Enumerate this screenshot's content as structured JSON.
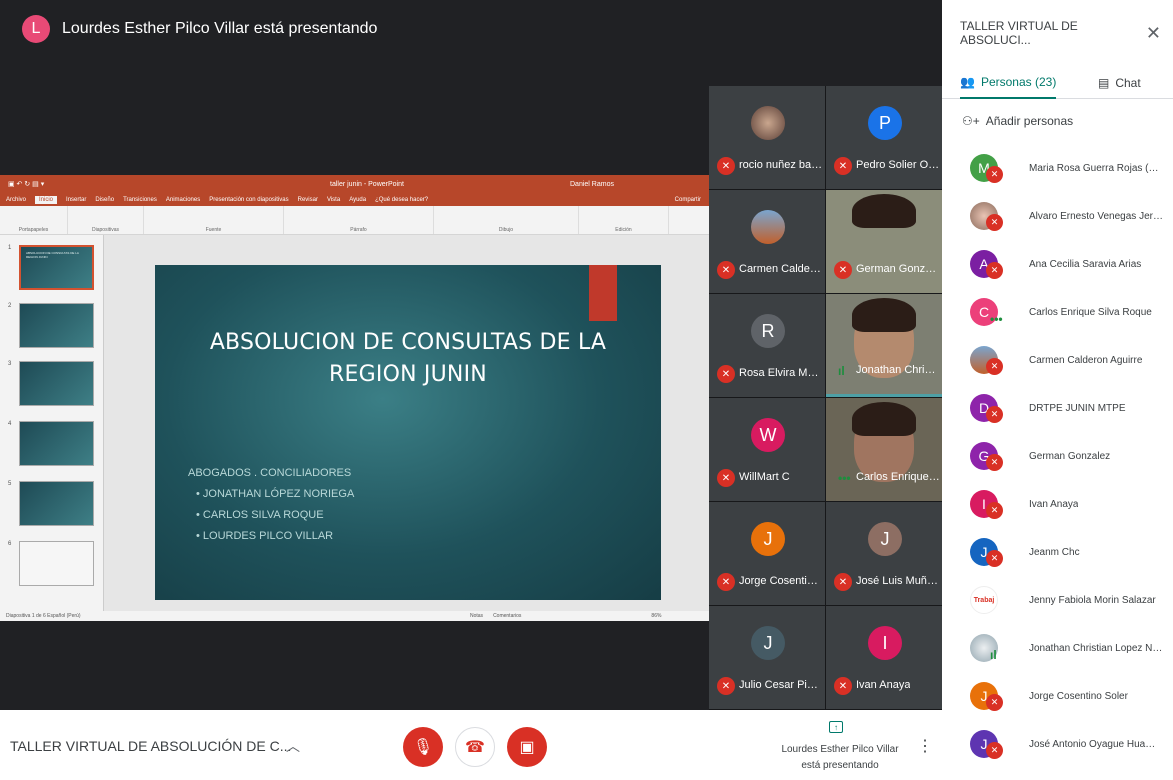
{
  "presenter": {
    "initial": "L",
    "text": "Lourdes Esther Pilco Villar está presentando"
  },
  "ppt": {
    "title": "taller junin - PowerPoint",
    "user": "Daniel Ramos",
    "tabs": [
      "Archivo",
      "Inicio",
      "Insertar",
      "Diseño",
      "Transiciones",
      "Animaciones",
      "Presentación con diapositivas",
      "Revisar",
      "Vista",
      "Ayuda",
      "¿Qué desea hacer?"
    ],
    "share": "Compartir",
    "ribbon_groups": [
      "Portapapeles",
      "Diapositivas",
      "Fuente",
      "Párrafo",
      "Dibujo",
      "Edición"
    ],
    "slide_title_1": "ABSOLUCION DE CONSULTAS DE LA",
    "slide_title_2": "REGION JUNIN",
    "slide_body": [
      "ABOGADOS . CONCILIADORES",
      "•  JONATHAN LÓPEZ NORIEGA",
      "•  CARLOS SILVA ROQUE",
      "•  LOURDES PILCO VILLAR"
    ],
    "status_left": "Diapositiva 1 de 6    Español (Perú)",
    "status_notes": "Notas",
    "status_comments": "Comentarios",
    "zoom": "86%",
    "thumb_numbers": [
      "1",
      "2",
      "3",
      "4",
      "5",
      "6"
    ],
    "thumb_texts": [
      "ABSOLUCION DE CONSULTAS DE LA REGION JUNIN",
      "",
      "",
      "",
      "",
      ""
    ]
  },
  "tiles": [
    {
      "name": "rocio nuñez bailon",
      "initial": "",
      "color": "#7d5a4e"
    },
    {
      "name": "Pedro Solier Och...",
      "initial": "P",
      "color": "#1a73e8"
    },
    {
      "name": "Carmen Caldero...",
      "initial": "",
      "color": "#c1602c"
    },
    {
      "name": "German Gonzalez",
      "initial": "",
      "color": ""
    },
    {
      "name": "Rosa Elvira Muda...",
      "initial": "R",
      "color": "#5f6368"
    },
    {
      "name": "Jonathan Christi...",
      "initial": "",
      "color": ""
    },
    {
      "name": "WillMart C",
      "initial": "W",
      "color": "#d81b60"
    },
    {
      "name": "Carlos Enrique Si...",
      "initial": "",
      "color": ""
    },
    {
      "name": "Jorge Cosentino ...",
      "initial": "J",
      "color": "#e8710a"
    },
    {
      "name": "José Luis Muñoz...",
      "initial": "J",
      "color": "#8d6e63"
    },
    {
      "name": "Julio Cesar Pino ...",
      "initial": "J",
      "color": "#455a64"
    },
    {
      "name": "Ivan Anaya",
      "initial": "I",
      "color": "#d81b60"
    }
  ],
  "sidebar": {
    "title": "TALLER VIRTUAL DE ABSOLUCI...",
    "people_tab": "Personas (23)",
    "chat_tab": "Chat",
    "add_people": "Añadir personas",
    "participants": [
      {
        "name": "Maria Rosa Guerra Rojas (Tú)",
        "initial": "M",
        "color": "#43a047"
      },
      {
        "name": "Alvaro Ernesto Venegas Jerem...",
        "initial": "",
        "color": "#b0bec5"
      },
      {
        "name": "Ana Cecilia Saravia Arias",
        "initial": "A",
        "color": "#7b1fa2"
      },
      {
        "name": "Carlos Enrique Silva Roque",
        "initial": "C",
        "color": "#ec407a"
      },
      {
        "name": "Carmen Calderon Aguirre",
        "initial": "",
        "color": "#c1602c"
      },
      {
        "name": "DRTPE JUNIN MTPE",
        "initial": "D",
        "color": "#8e24aa"
      },
      {
        "name": "German Gonzalez",
        "initial": "G",
        "color": "#8e24aa"
      },
      {
        "name": "Ivan Anaya",
        "initial": "I",
        "color": "#d81b60"
      },
      {
        "name": "Jeanm Chc",
        "initial": "J",
        "color": "#1565c0"
      },
      {
        "name": "Jenny Fabiola Morin Salazar",
        "initial": "",
        "color": "#ffffff"
      },
      {
        "name": "Jonathan Christian Lopez Nori...",
        "initial": "",
        "color": "#90a4ae"
      },
      {
        "name": "Jorge Cosentino Soler",
        "initial": "J",
        "color": "#e8710a"
      },
      {
        "name": "José Antonio Oyague Huamani",
        "initial": "J",
        "color": "#5e35b1"
      }
    ],
    "jenny_logo_text": "Trabaj"
  },
  "bottom": {
    "meeting_title": "TALLER VIRTUAL DE ABSOLUCIÓN DE C...",
    "presenting_line1": "Lourdes Esther Pilco Villar",
    "presenting_line2": "está presentando"
  },
  "colors": {
    "accent_teal": "#00796b",
    "muted_red": "#d93025",
    "ppt_orange": "#b7472a"
  },
  "icons": [
    "mic-off-icon",
    "hangup-icon",
    "camera-off-icon",
    "present-icon",
    "more-icon",
    "close-icon",
    "people-icon",
    "chat-icon",
    "add-person-icon",
    "chevron-up-icon"
  ]
}
